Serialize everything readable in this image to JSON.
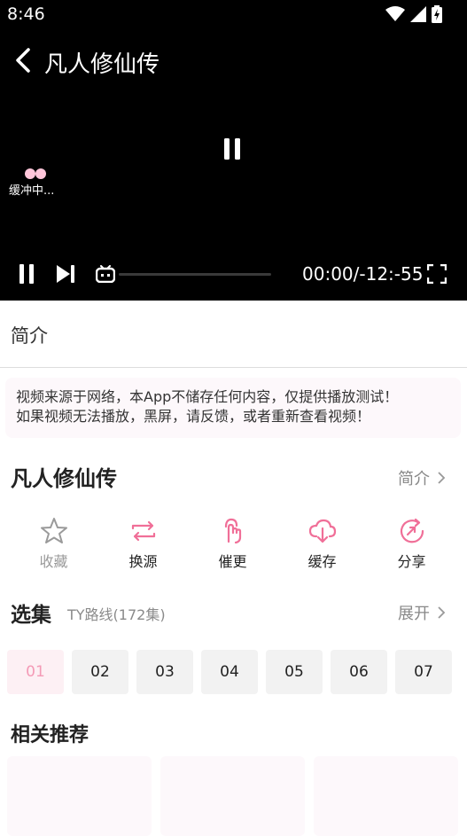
{
  "status_bar": {
    "time": "8:46"
  },
  "player": {
    "title": "凡人修仙传",
    "buffer_text": "缓冲中...",
    "time_readout": "00:00/-12:-55",
    "progress": 0
  },
  "tabs": {
    "intro_label": "简介"
  },
  "notice": {
    "line1": "视频来源于网络，本App不储存任何内容，仅提供播放测试！",
    "line2": "如果视频无法播放，黑屏，请反馈，或者重新查看视频！"
  },
  "show": {
    "title": "凡人修仙传",
    "intro_link": "简介"
  },
  "actions": [
    {
      "label": "收藏",
      "icon": "star-icon"
    },
    {
      "label": "换源",
      "icon": "switch-source-icon"
    },
    {
      "label": "催更",
      "icon": "urge-update-icon"
    },
    {
      "label": "缓存",
      "icon": "cloud-download-icon"
    },
    {
      "label": "分享",
      "icon": "share-icon"
    }
  ],
  "episodes": {
    "title": "选集",
    "route": "TY路线(172集)",
    "expand_label": "展开",
    "items": [
      "01",
      "02",
      "03",
      "04",
      "05",
      "06",
      "07"
    ],
    "active_index": 0
  },
  "related": {
    "title": "相关推荐"
  },
  "colors": {
    "accent": "#f06f98",
    "active_ep_text": "#f49ab6",
    "muted": "#9a9a9a"
  }
}
